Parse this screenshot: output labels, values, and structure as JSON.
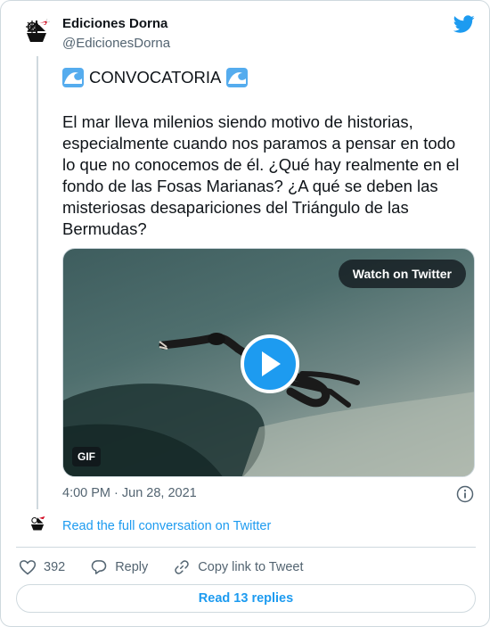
{
  "author": {
    "name": "Ediciones Dorna",
    "handle": "@EdicionesDorna"
  },
  "tweet": {
    "headline": "CONVOCATORIA",
    "headline_emoji": "water-wave-icon",
    "body": "El mar lleva milenios siendo motivo de historias, especialmente cuando nos paramos a pensar en todo lo que no conocemos de él. ¿Qué hay realmente en el fondo de las Fosas Marianas? ¿A qué se deben las misteriosas desapariciones del Triángulo de las Bermudas?",
    "timestamp": "4:00 PM · Jun 28, 2021"
  },
  "media": {
    "watch_label": "Watch on Twitter",
    "badge": "GIF"
  },
  "conversation_link": "Read the full conversation on Twitter",
  "actions": {
    "likes": "392",
    "reply_label": "Reply",
    "copy_label": "Copy link to Tweet"
  },
  "replies_button": "Read 13 replies",
  "colors": {
    "accent": "#1d9bf0",
    "secondary_text": "#536471",
    "border": "#cfd9de"
  }
}
